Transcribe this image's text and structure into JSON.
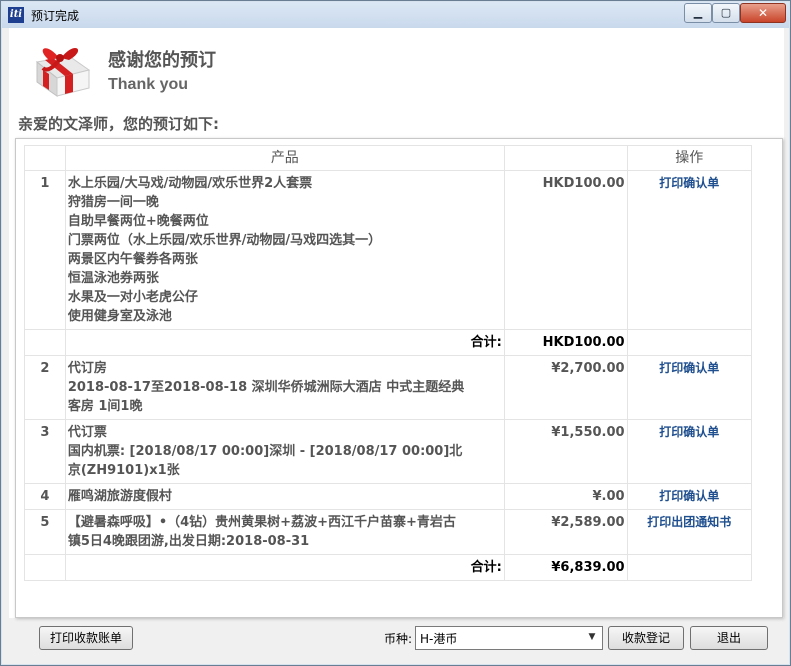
{
  "window": {
    "title": "预订完成"
  },
  "header": {
    "thanks_cn": "感谢您的预订",
    "thanks_en": "Thank you"
  },
  "greeting": "亲爱的文泽师，您的预订如下:",
  "table": {
    "col_product": "产品",
    "col_action": "操作",
    "rows": [
      {
        "num": "1",
        "lines": [
          "水上乐园/大马戏/动物园/欢乐世界2人套票",
          "狩猎房一间一晚",
          "自助早餐两位+晚餐两位",
          "门票两位（水上乐园/欢乐世界/动物园/马戏四选其一）",
          "两景区内午餐券各两张",
          "恒温泳池券两张",
          "水果及一对小老虎公仔",
          "使用健身室及泳池"
        ],
        "price": "HKD100.00",
        "action": "打印确认单"
      },
      {
        "num": "2",
        "lines": [
          "代订房",
          "2018-08-17至2018-08-18 深圳华侨城洲际大酒店 中式主题经典",
          "客房 1间1晚"
        ],
        "price": "¥2,700.00",
        "action": "打印确认单"
      },
      {
        "num": "3",
        "lines": [
          "代订票",
          "国内机票: [2018/08/17 00:00]深圳 - [2018/08/17 00:00]北",
          "京(ZH9101)x1张"
        ],
        "price": "¥1,550.00",
        "action": "打印确认单"
      },
      {
        "num": "4",
        "lines": [
          "雁鸣湖旅游度假村"
        ],
        "price": "¥.00",
        "action": "打印确认单"
      },
      {
        "num": "5",
        "lines": [
          "【避暑森呼吸】•（4钻）贵州黄果树+荔波+西江千户苗寨+青岩古",
          "镇5日4晚跟团游,出发日期:2018-08-31"
        ],
        "price": "¥2,589.00",
        "action": "打印出团通知书"
      }
    ],
    "subtotal1": {
      "label": "合计:",
      "value": "HKD100.00"
    },
    "subtotal2": {
      "label": "合计:",
      "value": "¥6,839.00"
    }
  },
  "footer": {
    "print_receipt": "打印收款账单",
    "currency_label": "币种:",
    "currency_value": "H-港币",
    "register_payment": "收款登记",
    "exit": "退出"
  },
  "icons": {
    "app": "app-icon",
    "gift": "gift-icon"
  }
}
